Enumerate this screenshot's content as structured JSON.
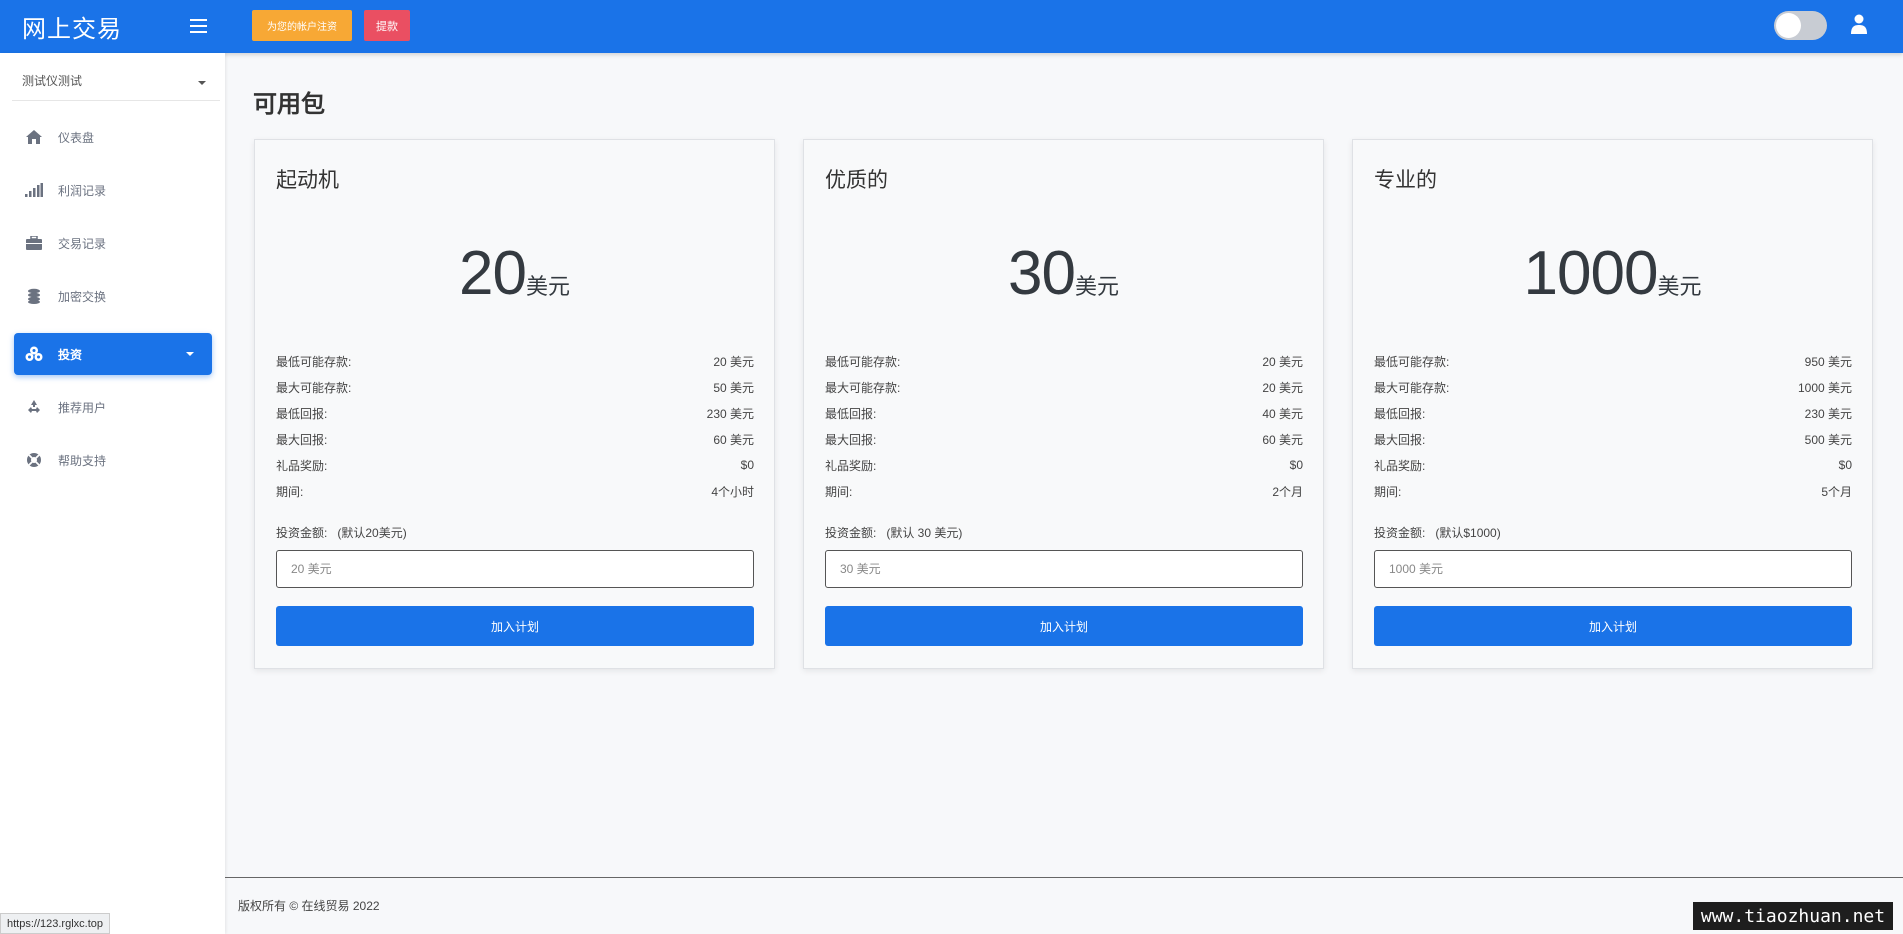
{
  "header": {
    "brand": "网上交易",
    "register_label": "为您的帐户注资",
    "withdraw_label": "提款",
    "colors": {
      "primary": "#1a73e8",
      "register": "#f7a835",
      "withdraw": "#ea4f62"
    }
  },
  "sidebar": {
    "account": "测试仪测试",
    "items": [
      {
        "label": "仪表盘",
        "icon": "home-icon"
      },
      {
        "label": "利润记录",
        "icon": "signal-bars-icon"
      },
      {
        "label": "交易记录",
        "icon": "briefcase-icon"
      },
      {
        "label": "加密交换",
        "icon": "coins-icon"
      },
      {
        "label": "投资",
        "icon": "cubes-icon",
        "active": true
      },
      {
        "label": "推荐用户",
        "icon": "recycle-icon"
      },
      {
        "label": "帮助支持",
        "icon": "lifebuoy-icon"
      }
    ]
  },
  "main": {
    "title": "可用包",
    "packages": [
      {
        "name": "起动机",
        "amount": "20",
        "unit": "美元",
        "rows": [
          {
            "label": "最低可能存款:",
            "value": "20 美元"
          },
          {
            "label": "最大可能存款:",
            "value": "50 美元"
          },
          {
            "label": "最低回报:",
            "value": "230 美元"
          },
          {
            "label": "最大回报:",
            "value": "60 美元"
          },
          {
            "label": "礼品奖励:",
            "value": "$0"
          },
          {
            "label": "期间:",
            "value": "4个小时"
          }
        ],
        "invest_label": "投资金额:",
        "invest_default": "(默认20美元)",
        "placeholder": "20 美元",
        "button": "加入计划"
      },
      {
        "name": "优质的",
        "amount": "30",
        "unit": "美元",
        "rows": [
          {
            "label": "最低可能存款:",
            "value": "20 美元"
          },
          {
            "label": "最大可能存款:",
            "value": "20 美元"
          },
          {
            "label": "最低回报:",
            "value": "40 美元"
          },
          {
            "label": "最大回报:",
            "value": "60 美元"
          },
          {
            "label": "礼品奖励:",
            "value": "$0"
          },
          {
            "label": "期间:",
            "value": "2个月"
          }
        ],
        "invest_label": "投资金额:",
        "invest_default": "(默认 30 美元)",
        "placeholder": "30 美元",
        "button": "加入计划"
      },
      {
        "name": "专业的",
        "amount": "1000",
        "unit": "美元",
        "rows": [
          {
            "label": "最低可能存款:",
            "value": "950 美元"
          },
          {
            "label": "最大可能存款:",
            "value": "1000 美元"
          },
          {
            "label": "最低回报:",
            "value": "230 美元"
          },
          {
            "label": "最大回报:",
            "value": "500 美元"
          },
          {
            "label": "礼品奖励:",
            "value": "$0"
          },
          {
            "label": "期间:",
            "value": "5个月"
          }
        ],
        "invest_label": "投资金额:",
        "invest_default": "(默认$1000)",
        "placeholder": "1000 美元",
        "button": "加入计划"
      }
    ]
  },
  "footer": {
    "copyright": "版权所有 © 在线贸易 2022"
  },
  "status_url": "https://123.rglxc.top",
  "watermark": "www.tiaozhuan.net"
}
